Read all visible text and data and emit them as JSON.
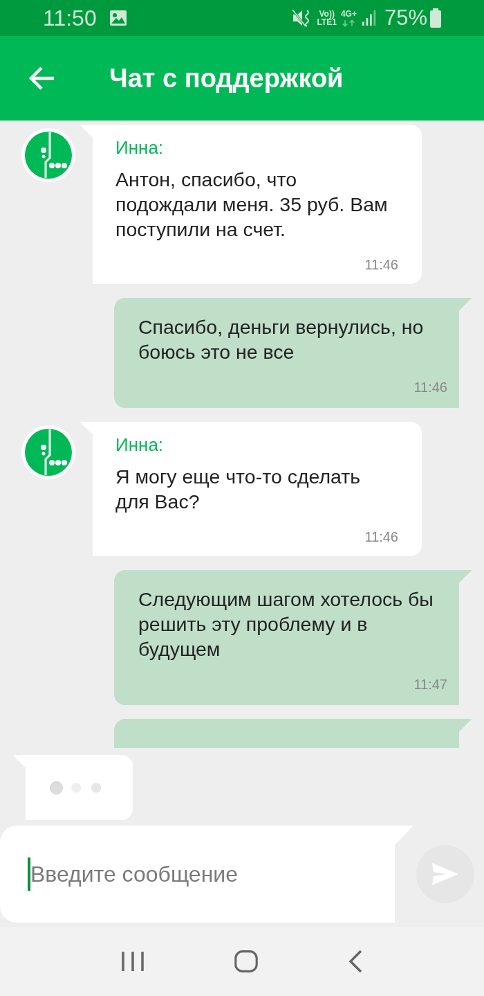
{
  "status_bar": {
    "time": "11:50",
    "volte": "Vo))",
    "lte": "LTE1",
    "network": "4G+",
    "battery": "75%"
  },
  "app_bar": {
    "title": "Чат с поддержкой"
  },
  "messages": [
    {
      "kind": "incoming",
      "sender": "Инна:",
      "text": "Антон, спасибо, что подождали меня. 35 руб. Вам поступили на счет.",
      "time": "11:46"
    },
    {
      "kind": "outgoing",
      "text": "Спасибо, деньги вернулись, но боюсь это не все",
      "time": "11:46"
    },
    {
      "kind": "incoming",
      "sender": "Инна:",
      "text": "Я могу еще что-то сделать для Вас?",
      "time": "11:46"
    },
    {
      "kind": "outgoing",
      "text": "Следующим шагом хотелось бы решить эту проблему и в будущем",
      "time": "11:47"
    },
    {
      "kind": "outgoing"
    }
  ],
  "typing_indicator": {
    "shown": true
  },
  "composer": {
    "placeholder": "Введите сообщение"
  }
}
